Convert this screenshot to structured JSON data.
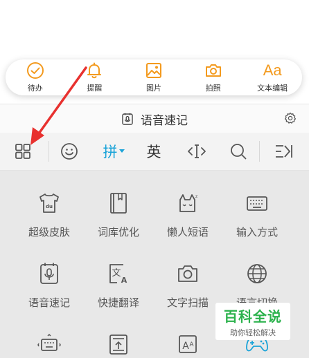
{
  "quickbar": {
    "items": [
      {
        "label": "待办",
        "icon": "check-circle-icon"
      },
      {
        "label": "提醒",
        "icon": "bell-icon"
      },
      {
        "label": "图片",
        "icon": "image-icon"
      },
      {
        "label": "拍照",
        "icon": "camera-icon"
      },
      {
        "label": "文本编辑",
        "icon": "text-edit-icon",
        "glyph": "Aa"
      }
    ],
    "accent_color": "#f39a1e"
  },
  "voicebar": {
    "title": "语音速记",
    "icon": "voice-note-icon",
    "settings_icon": "gear-icon"
  },
  "keyboard_toolbar": {
    "items": [
      {
        "name": "menu-grid",
        "icon": "grid-icon"
      },
      {
        "name": "emoji",
        "icon": "smiley-icon"
      },
      {
        "name": "pinyin",
        "text": "拼",
        "active": true
      },
      {
        "name": "english",
        "text": "英"
      },
      {
        "name": "cursor",
        "icon": "cursor-move-icon"
      },
      {
        "name": "search",
        "icon": "search-icon"
      },
      {
        "name": "collapse",
        "icon": "collapse-keyboard-icon"
      }
    ],
    "active_color": "#1aa3d8"
  },
  "menu": {
    "rows": [
      [
        {
          "label": "超级皮肤",
          "icon": "tshirt-icon"
        },
        {
          "label": "词库优化",
          "icon": "book-icon"
        },
        {
          "label": "懒人短语",
          "icon": "lazy-cat-icon"
        },
        {
          "label": "输入方式",
          "icon": "keyboard-icon"
        }
      ],
      [
        {
          "label": "语音速记",
          "icon": "voice-note-icon"
        },
        {
          "label": "快捷翻译",
          "icon": "translate-icon"
        },
        {
          "label": "文字扫描",
          "icon": "camera-icon"
        },
        {
          "label": "语言切换",
          "icon": "globe-icon"
        }
      ],
      [
        {
          "label": "",
          "icon": "keyboard-resize-icon"
        },
        {
          "label": "",
          "icon": "keyboard-height-icon"
        },
        {
          "label": "",
          "icon": "font-size-icon"
        },
        {
          "label": "",
          "icon": "game-controller-icon"
        }
      ]
    ]
  },
  "watermark": {
    "title": "百科全说",
    "subtitle": "助你轻松解决"
  },
  "annotation": {
    "arrow_color": "#e8312f"
  }
}
